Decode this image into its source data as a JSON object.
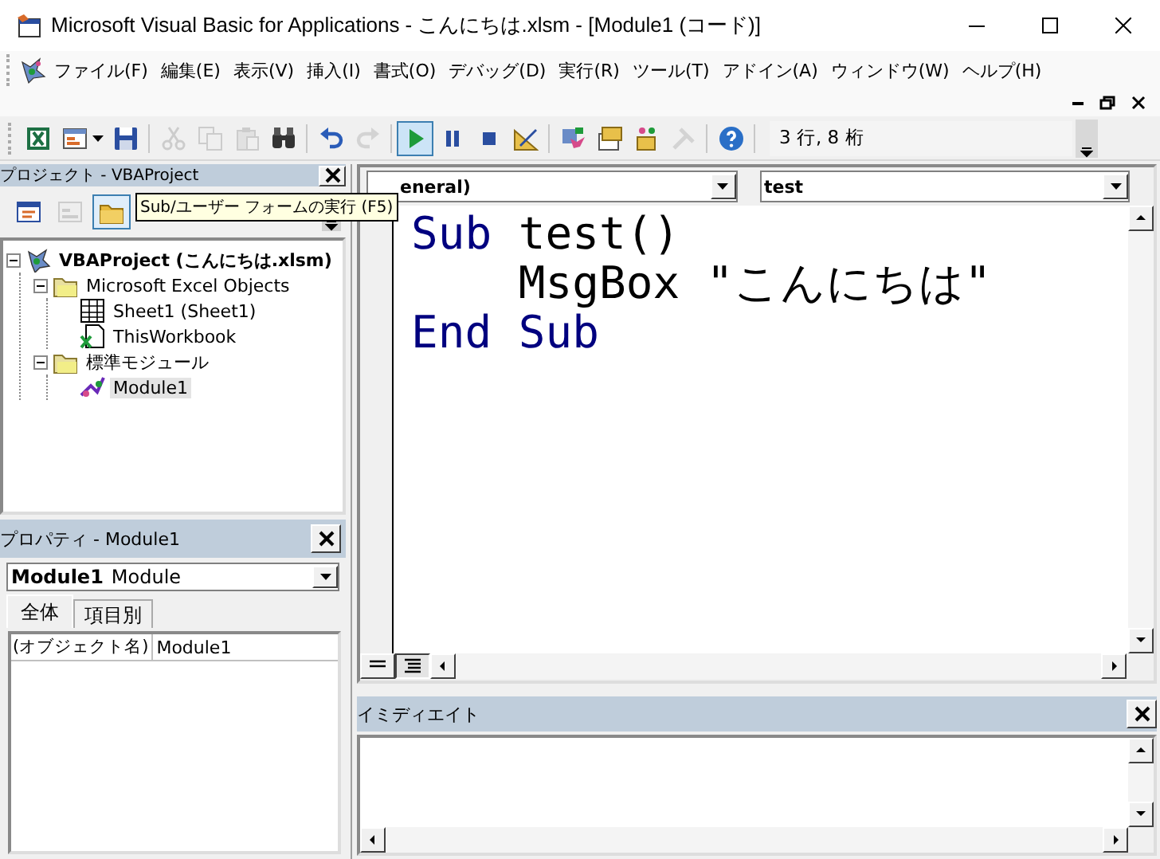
{
  "window": {
    "title": "Microsoft Visual Basic for Applications - こんにちは.xlsm - [Module1 (コード)]"
  },
  "menu": [
    {
      "label": "ファイル(F)"
    },
    {
      "label": "編集(E)"
    },
    {
      "label": "表示(V)"
    },
    {
      "label": "挿入(I)"
    },
    {
      "label": "書式(O)"
    },
    {
      "label": "デバッグ(D)"
    },
    {
      "label": "実行(R)"
    },
    {
      "label": "ツール(T)"
    },
    {
      "label": "アドイン(A)"
    },
    {
      "label": "ウィンドウ(W)"
    },
    {
      "label": "ヘルプ(H)"
    }
  ],
  "toolbar": {
    "buttons": [
      {
        "kind": "excel",
        "disabled": false,
        "highlighted": false
      },
      {
        "kind": "insert-form",
        "disabled": false,
        "highlighted": false
      },
      {
        "kind": "save",
        "disabled": false,
        "highlighted": false
      },
      {
        "kind": "separator"
      },
      {
        "kind": "cut",
        "disabled": true,
        "highlighted": false
      },
      {
        "kind": "copy",
        "disabled": true,
        "highlighted": false
      },
      {
        "kind": "paste",
        "disabled": true,
        "highlighted": false
      },
      {
        "kind": "find",
        "disabled": false,
        "highlighted": false
      },
      {
        "kind": "separator"
      },
      {
        "kind": "undo",
        "disabled": false,
        "highlighted": false
      },
      {
        "kind": "redo",
        "disabled": true,
        "highlighted": false
      },
      {
        "kind": "separator"
      },
      {
        "kind": "run",
        "disabled": false,
        "highlighted": true
      },
      {
        "kind": "pause",
        "disabled": false,
        "highlighted": false
      },
      {
        "kind": "stop",
        "disabled": false,
        "highlighted": false
      },
      {
        "kind": "design",
        "disabled": false,
        "highlighted": false
      },
      {
        "kind": "separator"
      },
      {
        "kind": "project",
        "disabled": false,
        "highlighted": false
      },
      {
        "kind": "properties",
        "disabled": false,
        "highlighted": false
      },
      {
        "kind": "object-browser",
        "disabled": false,
        "highlighted": false
      },
      {
        "kind": "toolbox",
        "disabled": true,
        "highlighted": false
      },
      {
        "kind": "separator"
      },
      {
        "kind": "help",
        "disabled": false,
        "highlighted": false
      }
    ],
    "position": "3 行, 8 桁"
  },
  "tooltip": "Sub/ユーザー フォームの実行 (F5)",
  "project": {
    "title": "プロジェクト - VBAProject",
    "buttons": [
      {
        "kind": "view-code",
        "disabled": false,
        "selected": false
      },
      {
        "kind": "view-object",
        "disabled": true,
        "selected": false
      },
      {
        "kind": "toggle-folders",
        "disabled": false,
        "selected": true
      }
    ],
    "tree": [
      {
        "label": "VBAProject (こんにちは.xlsm)",
        "kind": "project",
        "expanded": true,
        "selected": false,
        "children": [
          {
            "label": "Microsoft Excel Objects",
            "kind": "folder",
            "expanded": true,
            "selected": false,
            "children": [
              {
                "label": "Sheet1 (Sheet1)",
                "kind": "sheet",
                "selected": false
              },
              {
                "label": "ThisWorkbook",
                "kind": "workbook",
                "selected": false
              }
            ]
          },
          {
            "label": "標準モジュール",
            "kind": "folder",
            "expanded": true,
            "selected": false,
            "children": [
              {
                "label": "Module1",
                "kind": "module",
                "selected": true
              }
            ]
          }
        ]
      }
    ]
  },
  "properties": {
    "title": "プロパティ - Module1",
    "object_name": "Module1",
    "object_type": "Module",
    "tabs": [
      {
        "label": "全体",
        "selected": true
      },
      {
        "label": "項目別",
        "selected": false
      }
    ],
    "rows": [
      {
        "name": "(オブジェクト名)",
        "value": "Module1"
      }
    ]
  },
  "code": {
    "object": "eneral)",
    "procedure": "test",
    "lines": [
      [
        {
          "kind": "keyword",
          "text": "Sub"
        },
        {
          "kind": "plain",
          "text": " test()"
        }
      ],
      [
        {
          "kind": "plain",
          "text": "    MsgBox \"こんにちは\""
        }
      ],
      [
        {
          "kind": "keyword",
          "text": "End Sub"
        }
      ]
    ],
    "view_buttons": [
      {
        "kind": "procedure",
        "selected": false
      },
      {
        "kind": "module",
        "selected": true
      }
    ]
  },
  "immediate": {
    "title": "イミディエイト"
  }
}
